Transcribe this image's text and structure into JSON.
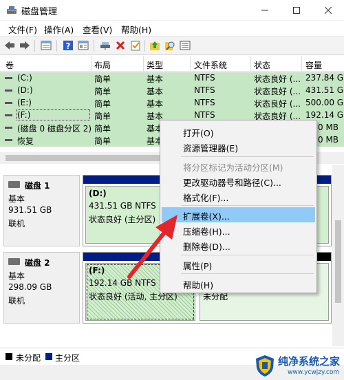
{
  "window": {
    "title": "磁盘管理",
    "minimize_icon": "minimize-icon",
    "maximize_icon": "maximize-icon",
    "close_icon": "close-icon"
  },
  "menubar": [
    {
      "label": "文件(F)"
    },
    {
      "label": "操作(A)"
    },
    {
      "label": "查看(V)"
    },
    {
      "label": "帮助(H)"
    }
  ],
  "toolbar": {
    "icons": [
      "back-arrow-icon",
      "forward-arrow-icon",
      "volume-list-icon",
      "help-icon",
      "properties-icon",
      "connect-icon",
      "delete-icon",
      "check-icon",
      "folder-up-icon",
      "search-icon",
      "list-view-icon"
    ]
  },
  "volume_list": {
    "columns": [
      "卷",
      "布局",
      "类型",
      "文件系统",
      "状态",
      "容量"
    ],
    "rows": [
      {
        "volume": "(C:)",
        "layout": "简单",
        "type": "基本",
        "fs": "NTFS",
        "status": "状态良好 (...",
        "capacity": "237.84 G"
      },
      {
        "volume": "(D:)",
        "layout": "简单",
        "type": "基本",
        "fs": "NTFS",
        "status": "状态良好 (...",
        "capacity": "431.51 G"
      },
      {
        "volume": "(E:)",
        "layout": "简单",
        "type": "基本",
        "fs": "NTFS",
        "status": "状态良好 (...",
        "capacity": "500.00 G"
      },
      {
        "volume": "(F:)",
        "layout": "简单",
        "type": "基本",
        "fs": "NTFS",
        "status": "状态良好 (...",
        "capacity": "192.14 G"
      },
      {
        "volume": "(磁盘 0 磁盘分区 2)",
        "layout": "简单",
        "type": "基本",
        "fs": "",
        "status": "",
        "capacity": "0 MB"
      },
      {
        "volume": "恢复",
        "layout": "简单",
        "type": "基本",
        "fs": "",
        "status": "",
        "capacity": "0 MB"
      }
    ]
  },
  "disks": [
    {
      "name": "磁盘 1",
      "kind": "基本",
      "size": "931.51 GB",
      "state": "联机",
      "partition": {
        "label": "(D:)",
        "size_fs": "431.51 GB NTFS",
        "status": "状态良好 (主分区)"
      }
    },
    {
      "name": "磁盘 2",
      "kind": "基本",
      "size": "298.09 GB",
      "state": "联机",
      "partition": {
        "label": "(F:)",
        "size_fs": "192.14 GB NTFS",
        "status": "状态良好 (活动, 主分区)"
      },
      "unallocated": {
        "label": "未分配"
      }
    }
  ],
  "legend": [
    {
      "label": "未分配",
      "color": "#000000"
    },
    {
      "label": "主分区",
      "color": "#001e86"
    }
  ],
  "context_menu": {
    "items": [
      {
        "label": "打开(O)",
        "disabled": false
      },
      {
        "label": "资源管理器(E)",
        "disabled": false
      },
      {
        "label": "将分区标记为活动分区(M)",
        "disabled": true
      },
      {
        "label": "更改驱动器号和路径(C)...",
        "disabled": false
      },
      {
        "label": "格式化(F)...",
        "disabled": false
      },
      {
        "label": "扩展卷(X)...",
        "disabled": false,
        "highlighted": true
      },
      {
        "label": "压缩卷(H)...",
        "disabled": false
      },
      {
        "label": "删除卷(D)...",
        "disabled": false
      },
      {
        "label": "属性(P)",
        "disabled": false
      },
      {
        "label": "帮助(H)",
        "disabled": false
      }
    ]
  },
  "watermark": {
    "title": "纯净系统之家",
    "url": "www.ycwjzy.com"
  },
  "colors": {
    "row_green": "#c5e7c4",
    "primary_partition": "#001e86",
    "menu_highlight": "#91c9f7",
    "arrow_red": "#e3262b"
  }
}
